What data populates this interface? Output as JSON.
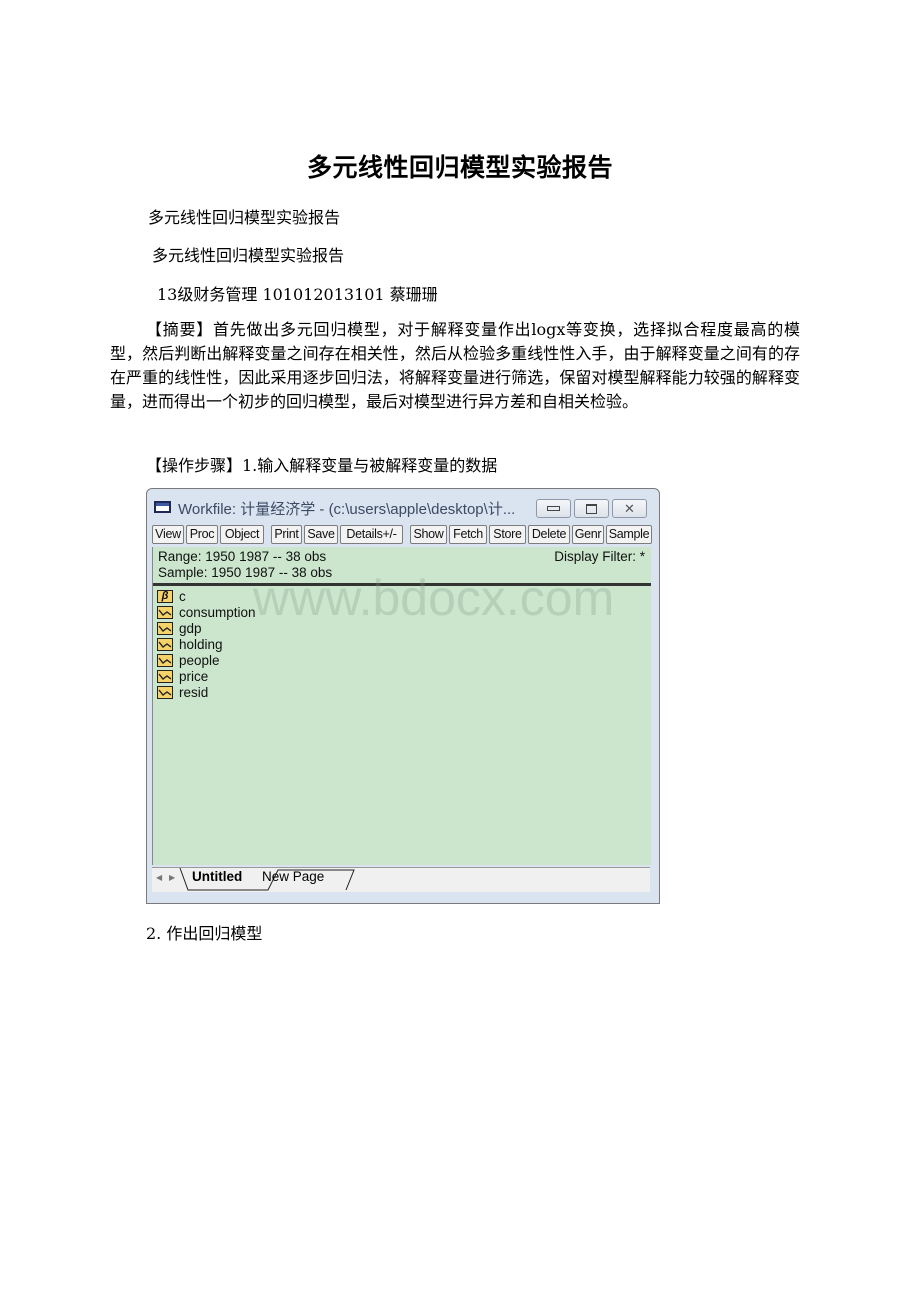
{
  "document": {
    "title": "多元线性回归模型实验报告",
    "subtitle_1": "多元线性回归模型实验报告",
    "subtitle_2": "多元线性回归模型实验报告",
    "author_line": "13级财务管理 101012013101 蔡珊珊",
    "abstract": "【摘要】首先做出多元回归模型，对于解释变量作出logx等变换，选择拟合程度最高的模型，然后判断出解释变量之间存在相关性，然后从检验多重线性性入手，由于解释变量之间有的存在严重的线性性，因此采用逐步回归法，将解释变量进行筛选，保留对模型解释能力较强的解释变量，进而得出一个初步的回归模型，最后对模型进行异方差和自相关检验。",
    "step_1": "【操作步骤】1.输入解释变量与被解释变量的数据",
    "step_2": "2. 作出回归模型"
  },
  "window": {
    "icon": "workfile-window-icon",
    "title": "Workfile: 计量经济学 - (c:\\users\\apple\\desktop\\计...",
    "controls": {
      "minimize": "minimize-icon",
      "maximize": "maximize-icon",
      "close": "close-icon"
    },
    "toolbar": [
      "View",
      "Proc",
      "Object",
      "Print",
      "Save",
      "Details+/-",
      "Show",
      "Fetch",
      "Store",
      "Delete",
      "Genr",
      "Sample"
    ],
    "range_label": "Range:  1950 1987  --  38 obs",
    "sample_label": "Sample: 1950 1987  --  38 obs",
    "display_filter": "Display Filter: *",
    "objects": [
      {
        "name": "c",
        "icon": "coefficient-icon"
      },
      {
        "name": "consumption",
        "icon": "series-icon"
      },
      {
        "name": "gdp",
        "icon": "series-icon"
      },
      {
        "name": "holding",
        "icon": "series-icon"
      },
      {
        "name": "people",
        "icon": "series-icon"
      },
      {
        "name": "price",
        "icon": "series-icon"
      },
      {
        "name": "resid",
        "icon": "series-icon"
      }
    ],
    "tabs": [
      "Untitled",
      "New Page"
    ],
    "active_tab": "Untitled"
  },
  "watermark": "www.bdocx.com",
  "colors": {
    "pane_bg": "#cce6ce",
    "frame": "#d9e4f0",
    "icon_fill": "#f6d26b"
  }
}
